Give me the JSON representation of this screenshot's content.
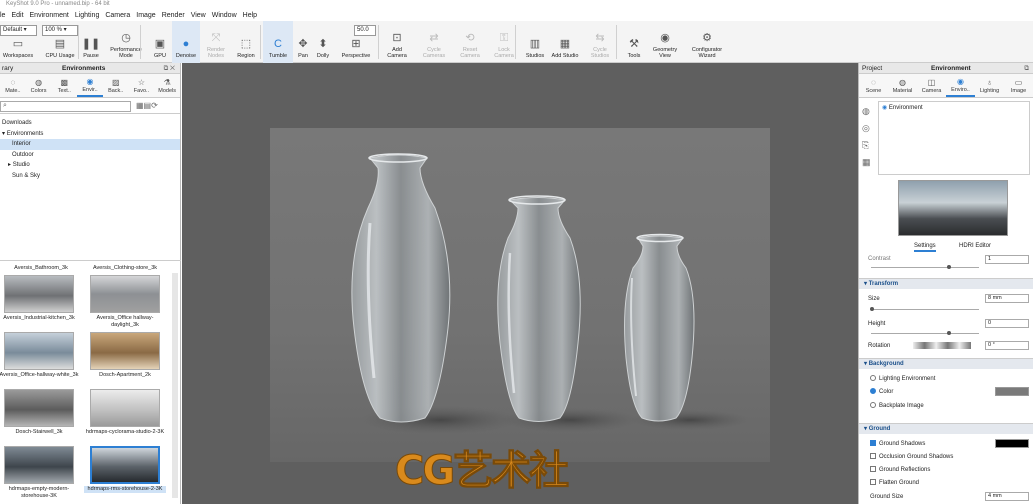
{
  "window": {
    "title": "KeyShot 9.0 Pro - unnamed.bip - 64 bit"
  },
  "menu": [
    "le",
    "Edit",
    "Environment",
    "Lighting",
    "Camera",
    "Image",
    "Render",
    "View",
    "Window",
    "Help"
  ],
  "toolbar": {
    "preset_combo": "Default",
    "zoom_combo": "100 %",
    "fov_value": "50.0",
    "buttons": [
      {
        "label": "Workspaces",
        "icon": "workspaces-icon"
      },
      {
        "label": "CPU Usage",
        "icon": "cpu-icon"
      },
      {
        "label": "Pause",
        "icon": "pause-icon"
      },
      {
        "label": "Performance Mode",
        "icon": "performance-icon"
      },
      {
        "label": "GPU",
        "icon": "gpu-icon"
      },
      {
        "label": "Denoise",
        "icon": "denoise-icon"
      },
      {
        "label": "Render Nodes",
        "icon": "render-nodes-icon"
      },
      {
        "label": "Region",
        "icon": "region-icon"
      },
      {
        "label": "Tumble",
        "icon": "tumble-icon"
      },
      {
        "label": "Pan",
        "icon": "pan-icon"
      },
      {
        "label": "Dolly",
        "icon": "dolly-icon"
      },
      {
        "label": "Perspective",
        "icon": "perspective-icon"
      },
      {
        "label": "Add Camera",
        "icon": "add-camera-icon"
      },
      {
        "label": "Cycle Cameras",
        "icon": "cycle-cameras-icon"
      },
      {
        "label": "Reset Camera",
        "icon": "reset-camera-icon"
      },
      {
        "label": "Lock Camera",
        "icon": "lock-camera-icon"
      },
      {
        "label": "Studios",
        "icon": "studios-icon"
      },
      {
        "label": "Add Studio",
        "icon": "add-studio-icon"
      },
      {
        "label": "Cycle Studios",
        "icon": "cycle-studios-icon"
      },
      {
        "label": "Tools",
        "icon": "tools-icon"
      },
      {
        "label": "Geometry View",
        "icon": "geometry-view-icon"
      },
      {
        "label": "Configurator Wizard",
        "icon": "configurator-icon"
      }
    ]
  },
  "library": {
    "header_left": "rary",
    "header_title": "Environments",
    "tabs": [
      "Mate..",
      "Colors",
      "Text..",
      "Envir..",
      "Back..",
      "Favo..",
      "Models"
    ],
    "tree": [
      "Downloads",
      "Environments",
      "Interior",
      "Outdoor",
      "Studio",
      "Sun & Sky"
    ],
    "top_labels": [
      "Aversis_Bathroom_3k",
      "Aversis_Clothing-store_3k"
    ],
    "thumbs": [
      "Aversis_Industrial-kitchen_3k",
      "Aversis_Office hallway-daylight_3k",
      "Aversis_Office-hallway-white_3k",
      "Dosch-Apartment_2k",
      "Dosch-Stairwell_3k",
      "hdrmaps-cyclorama-studio-2-3K",
      "hdrmaps-empty-modern-storehouse-3K",
      "hdrmaps-rms-storehouse-2-3K"
    ]
  },
  "project": {
    "header_left": "Project",
    "header_title": "Environment",
    "tabs": [
      "Scene",
      "Material",
      "Camera",
      "Enviro..",
      "Lighting",
      "Image"
    ],
    "list_item": "Environment",
    "subtabs": [
      "Settings",
      "HDRI Editor"
    ],
    "cut_label": "Contrast",
    "cut_value": "1",
    "transform": {
      "title": "Transform",
      "size_label": "Size",
      "size_value": "8 mm",
      "height_label": "Height",
      "height_value": "0",
      "rotation_label": "Rotation",
      "rotation_value": "0 °"
    },
    "background": {
      "title": "Background",
      "options": [
        "Lighting Environment",
        "Color",
        "Backplate Image"
      ]
    },
    "ground": {
      "title": "Ground",
      "options": [
        "Ground Shadows",
        "Occlusion Ground Shadows",
        "Ground Reflections",
        "Flatten Ground"
      ],
      "size_label": "Ground Size",
      "size_value": "4 mm"
    }
  },
  "watermark": "CG艺术社",
  "colors": {
    "accent": "#2d7fd3",
    "viewport": "#5f5f5f",
    "watermark": "#d98a1c"
  }
}
